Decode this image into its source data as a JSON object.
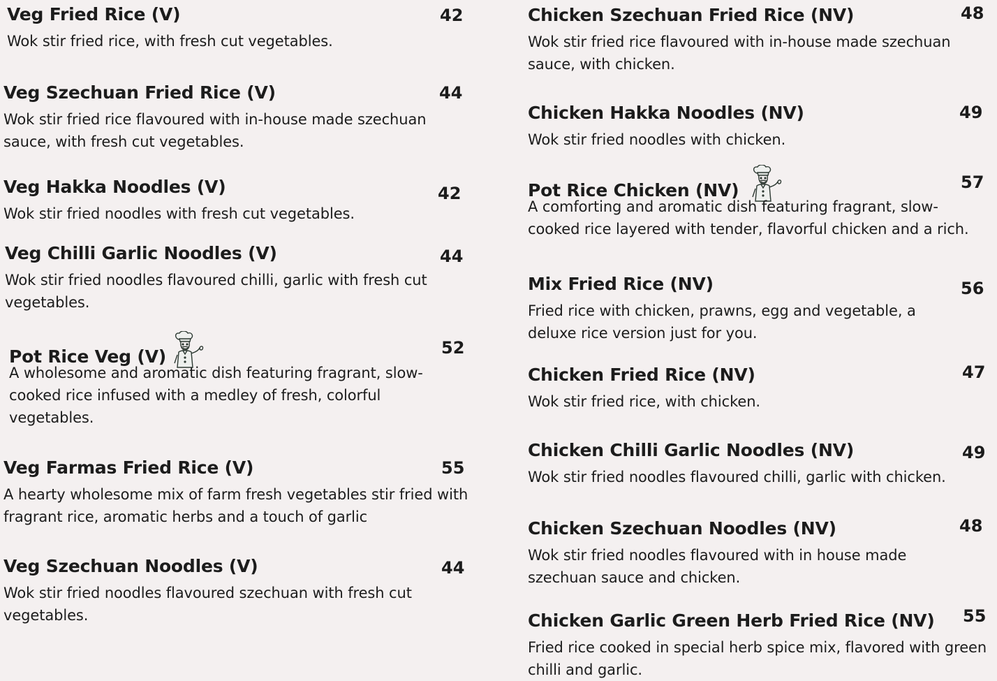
{
  "left_column": [
    {
      "name": "Veg Fried Rice (V)",
      "price": "42",
      "desc": "Wok stir fried rice, with fresh cut vegetables."
    },
    {
      "name": "Veg Szechuan Fried Rice (V)",
      "price": "44",
      "desc": "Wok stir fried rice flavoured with in-house made szechuan sauce, with fresh cut vegetables."
    },
    {
      "name": "Veg Hakka Noodles (V)",
      "price": "42",
      "desc": "Wok stir fried noodles with fresh cut vegetables."
    },
    {
      "name": "Veg Chilli Garlic Noodles (V)",
      "price": "44",
      "desc": "Wok stir fried noodles flavoured chilli, garlic with fresh cut vegetables."
    },
    {
      "name": "Pot Rice Veg (V)",
      "price": "52",
      "desc": "A wholesome and aromatic dish featuring fragrant, slow-cooked rice infused with a medley of fresh, colorful vegetables.",
      "icon": "chef-icon"
    },
    {
      "name": "Veg Farmas Fried Rice (V)",
      "price": "55",
      "desc": "A hearty wholesome mix of farm fresh vegetables stir fried with fragrant rice, aromatic herbs and a touch of garlic"
    },
    {
      "name": "Veg Szechuan Noodles (V)",
      "price": "44",
      "desc": "Wok stir fried noodles flavoured szechuan with fresh cut vegetables."
    }
  ],
  "right_column": [
    {
      "name": "Chicken Szechuan Fried Rice (NV)",
      "price": "48",
      "desc": "Wok stir fried rice flavoured with in-house made szechuan sauce, with chicken."
    },
    {
      "name": "Chicken Hakka Noodles (NV)",
      "price": "49",
      "desc": "Wok stir fried noodles with chicken."
    },
    {
      "name": "Pot Rice Chicken (NV)",
      "price": "57",
      "desc": "A comforting and aromatic dish featuring fragrant, slow-cooked rice layered with tender, flavorful chicken and a rich.",
      "icon": "chef-icon"
    },
    {
      "name": "Mix Fried Rice (NV)",
      "price": "56",
      "desc": "Fried rice with chicken, prawns, egg and vegetable, a deluxe rice version just for you."
    },
    {
      "name": "Chicken Fried Rice (NV)",
      "price": "47",
      "desc": "Wok stir fried rice, with chicken."
    },
    {
      "name": "Chicken Chilli Garlic Noodles (NV)",
      "price": "49",
      "desc": "Wok stir fried noodles flavoured chilli, garlic with chicken."
    },
    {
      "name": "Chicken Szechuan Noodles (NV)",
      "price": "48",
      "desc": "Wok stir fried noodles flavoured with in house made szechuan sauce and chicken."
    },
    {
      "name": "Chicken Garlic Green Herb Fried Rice (NV)",
      "price": "55",
      "desc": "Fried rice cooked in special herb spice mix, flavored with green chilli and garlic."
    }
  ]
}
